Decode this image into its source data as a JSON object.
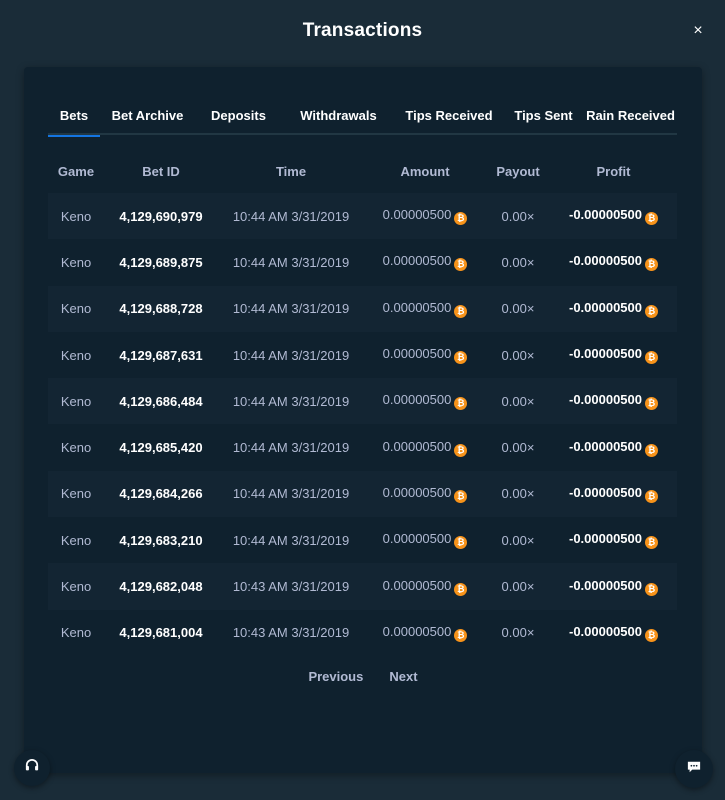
{
  "modal": {
    "title": "Transactions",
    "close_label": "×"
  },
  "tabs": [
    {
      "label": "Bets",
      "active": true
    },
    {
      "label": "Bet Archive",
      "active": false
    },
    {
      "label": "Deposits",
      "active": false
    },
    {
      "label": "Withdrawals",
      "active": false
    },
    {
      "label": "Tips Received",
      "active": false
    },
    {
      "label": "Tips Sent",
      "active": false
    },
    {
      "label": "Rain Received",
      "active": false
    }
  ],
  "table": {
    "headers": {
      "game": "Game",
      "bet_id": "Bet ID",
      "time": "Time",
      "amount": "Amount",
      "payout": "Payout",
      "profit": "Profit"
    },
    "rows": [
      {
        "game": "Keno",
        "bet_id": "4,129,690,979",
        "time": "10:44 AM 3/31/2019",
        "amount": "0.00000500",
        "payout": "0.00×",
        "profit": "-0.00000500"
      },
      {
        "game": "Keno",
        "bet_id": "4,129,689,875",
        "time": "10:44 AM 3/31/2019",
        "amount": "0.00000500",
        "payout": "0.00×",
        "profit": "-0.00000500"
      },
      {
        "game": "Keno",
        "bet_id": "4,129,688,728",
        "time": "10:44 AM 3/31/2019",
        "amount": "0.00000500",
        "payout": "0.00×",
        "profit": "-0.00000500"
      },
      {
        "game": "Keno",
        "bet_id": "4,129,687,631",
        "time": "10:44 AM 3/31/2019",
        "amount": "0.00000500",
        "payout": "0.00×",
        "profit": "-0.00000500"
      },
      {
        "game": "Keno",
        "bet_id": "4,129,686,484",
        "time": "10:44 AM 3/31/2019",
        "amount": "0.00000500",
        "payout": "0.00×",
        "profit": "-0.00000500"
      },
      {
        "game": "Keno",
        "bet_id": "4,129,685,420",
        "time": "10:44 AM 3/31/2019",
        "amount": "0.00000500",
        "payout": "0.00×",
        "profit": "-0.00000500"
      },
      {
        "game": "Keno",
        "bet_id": "4,129,684,266",
        "time": "10:44 AM 3/31/2019",
        "amount": "0.00000500",
        "payout": "0.00×",
        "profit": "-0.00000500"
      },
      {
        "game": "Keno",
        "bet_id": "4,129,683,210",
        "time": "10:44 AM 3/31/2019",
        "amount": "0.00000500",
        "payout": "0.00×",
        "profit": "-0.00000500"
      },
      {
        "game": "Keno",
        "bet_id": "4,129,682,048",
        "time": "10:43 AM 3/31/2019",
        "amount": "0.00000500",
        "payout": "0.00×",
        "profit": "-0.00000500"
      },
      {
        "game": "Keno",
        "bet_id": "4,129,681,004",
        "time": "10:43 AM 3/31/2019",
        "amount": "0.00000500",
        "payout": "0.00×",
        "profit": "-0.00000500"
      }
    ]
  },
  "currency": {
    "icon": "bitcoin-icon",
    "symbol": "₿",
    "color": "#f7931a"
  },
  "pagination": {
    "previous": "Previous",
    "next": "Next"
  },
  "floating": {
    "support_icon": "headset-icon",
    "chat_icon": "chat-bubble-icon"
  },
  "colors": {
    "background": "#1a2c38",
    "panel": "#0f212e",
    "row_alt": "#132533",
    "accent": "#1475e1",
    "text_muted": "#b1bad3",
    "text_bright": "#ffffff"
  }
}
